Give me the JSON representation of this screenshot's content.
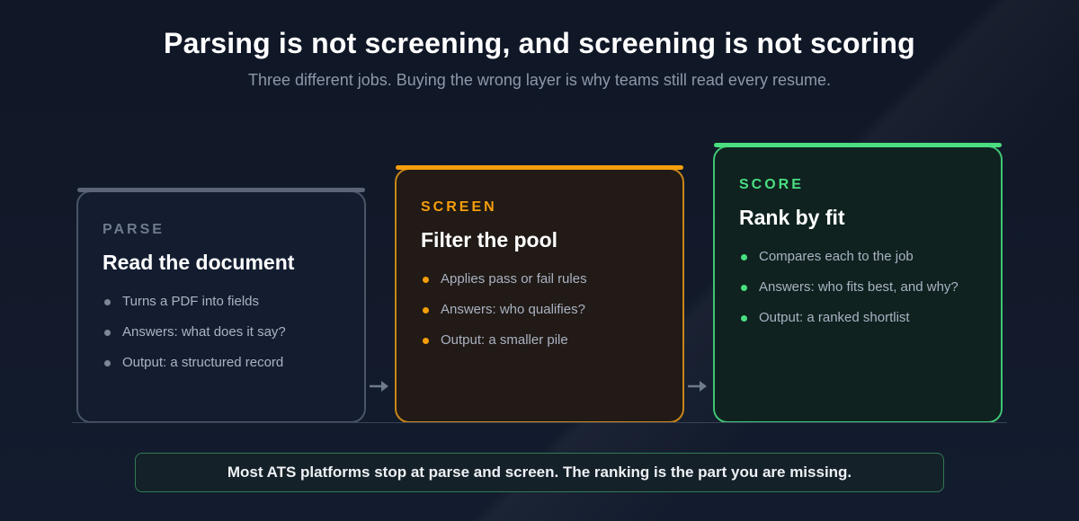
{
  "header": {
    "title": "Parsing is not screening, and screening is not scoring",
    "subtitle": "Three different jobs. Buying the wrong layer is why teams still read every resume."
  },
  "stages": [
    {
      "kicker": "PARSE",
      "heading": "Read the document",
      "accent_color": "#5b6577",
      "bullets": [
        "Turns a PDF into fields",
        "Answers: what does it say?",
        "Output: a structured record"
      ]
    },
    {
      "kicker": "SCREEN",
      "heading": "Filter the pool",
      "accent_color": "#f59e0b",
      "bullets": [
        "Applies pass or fail rules",
        "Answers: who qualifies?",
        "Output: a smaller pile"
      ]
    },
    {
      "kicker": "SCORE",
      "heading": "Rank by fit",
      "accent_color": "#4ade80",
      "bullets": [
        "Compares each to the job",
        "Answers: who fits best, and why?",
        "Output: a ranked shortlist"
      ]
    }
  ],
  "icons": [
    "arrow-right-icon",
    "bullet-dot-icon"
  ],
  "footer": {
    "banner": "Most ATS platforms stop at parse and screen. The ranking is the part you are missing."
  }
}
